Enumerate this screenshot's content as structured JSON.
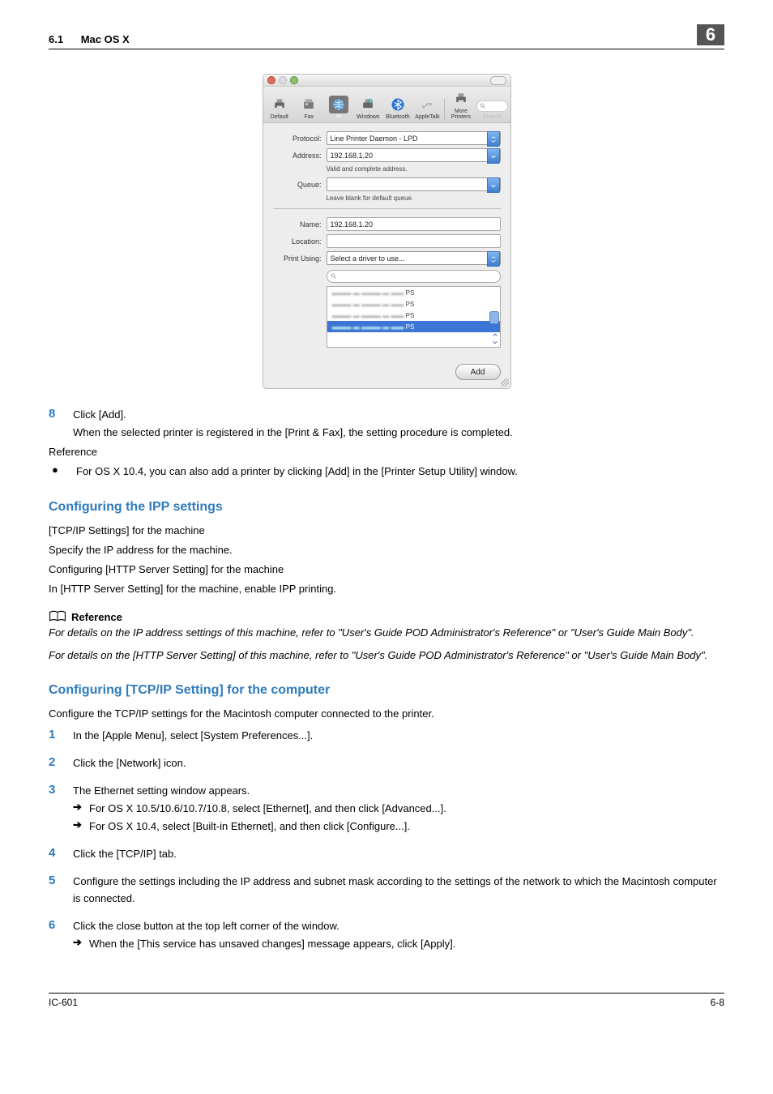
{
  "header": {
    "section_num": "6.1",
    "section_title": "Mac OS X",
    "chapter": "6"
  },
  "dialog": {
    "toolbar": {
      "default": "Default",
      "fax": "Fax",
      "ip": "IP",
      "windows": "Windows",
      "bluetooth": "Bluetooth",
      "appletalk": "AppleTalk",
      "more": "More Printers",
      "search": "Search"
    },
    "protocol_label": "Protocol:",
    "protocol_value": "Line Printer Daemon - LPD",
    "address_label": "Address:",
    "address_value": "192.168.1.20",
    "address_helper": "Valid and complete address.",
    "queue_label": "Queue:",
    "queue_value": "",
    "queue_helper": "Leave blank for default queue.",
    "name_label": "Name:",
    "name_value": "192.168.1.20",
    "location_label": "Location:",
    "location_value": "",
    "print_using_label": "Print Using:",
    "print_using_value": "Select a driver to use...",
    "driver_options": [
      "PS",
      "PS",
      "PS",
      "PS"
    ],
    "add_button": "Add"
  },
  "step8": {
    "num": "8",
    "text": "Click [Add]."
  },
  "step8_after": "When the selected printer is registered in the [Print & Fax], the setting procedure is completed.",
  "reference_label": "Reference",
  "ref_bullet": "For OS X 10.4, you can also add a printer by clicking [Add] in the [Printer Setup Utility] window.",
  "h3_ipp": "Configuring the IPP settings",
  "ipp_lines": {
    "l1": "[TCP/IP Settings] for the machine",
    "l2": "Specify the IP address for the machine.",
    "l3": "Configuring [HTTP Server Setting] for the machine",
    "l4": "In [HTTP Server Setting] for the machine, enable IPP printing."
  },
  "reference_head": "Reference",
  "ref_italic1": "For details on the IP address settings of this machine, refer to \"User's Guide POD Administrator's Reference\" or \"User's Guide Main Body\".",
  "ref_italic2": "For details on the [HTTP Server Setting] of this machine, refer to \"User's Guide POD Administrator's Reference\" or \"User's Guide Main Body\".",
  "h3_tcpip": "Configuring [TCP/IP Setting] for the computer",
  "tcpip_intro": "Configure the TCP/IP settings for the Macintosh computer connected to the printer.",
  "steps": {
    "s1": {
      "num": "1",
      "text": "In the [Apple Menu], select [System Preferences...]."
    },
    "s2": {
      "num": "2",
      "text": "Click the [Network] icon."
    },
    "s3": {
      "num": "3",
      "text": "The Ethernet setting window appears."
    },
    "s3a": "For OS X 10.5/10.6/10.7/10.8, select [Ethernet], and then click [Advanced...].",
    "s3b": "For OS X 10.4, select [Built-in Ethernet], and then click [Configure...].",
    "s4": {
      "num": "4",
      "text": "Click the [TCP/IP] tab."
    },
    "s5": {
      "num": "5",
      "text": "Configure the settings including the IP address and subnet mask according to the settings of the network to which the Macintosh computer is connected."
    },
    "s6": {
      "num": "6",
      "text": "Click the close button at the top left corner of the window."
    },
    "s6a": "When the [This service has unsaved changes] message appears, click [Apply]."
  },
  "footer": {
    "left": "IC-601",
    "right": "6-8"
  },
  "arrow": "➔"
}
